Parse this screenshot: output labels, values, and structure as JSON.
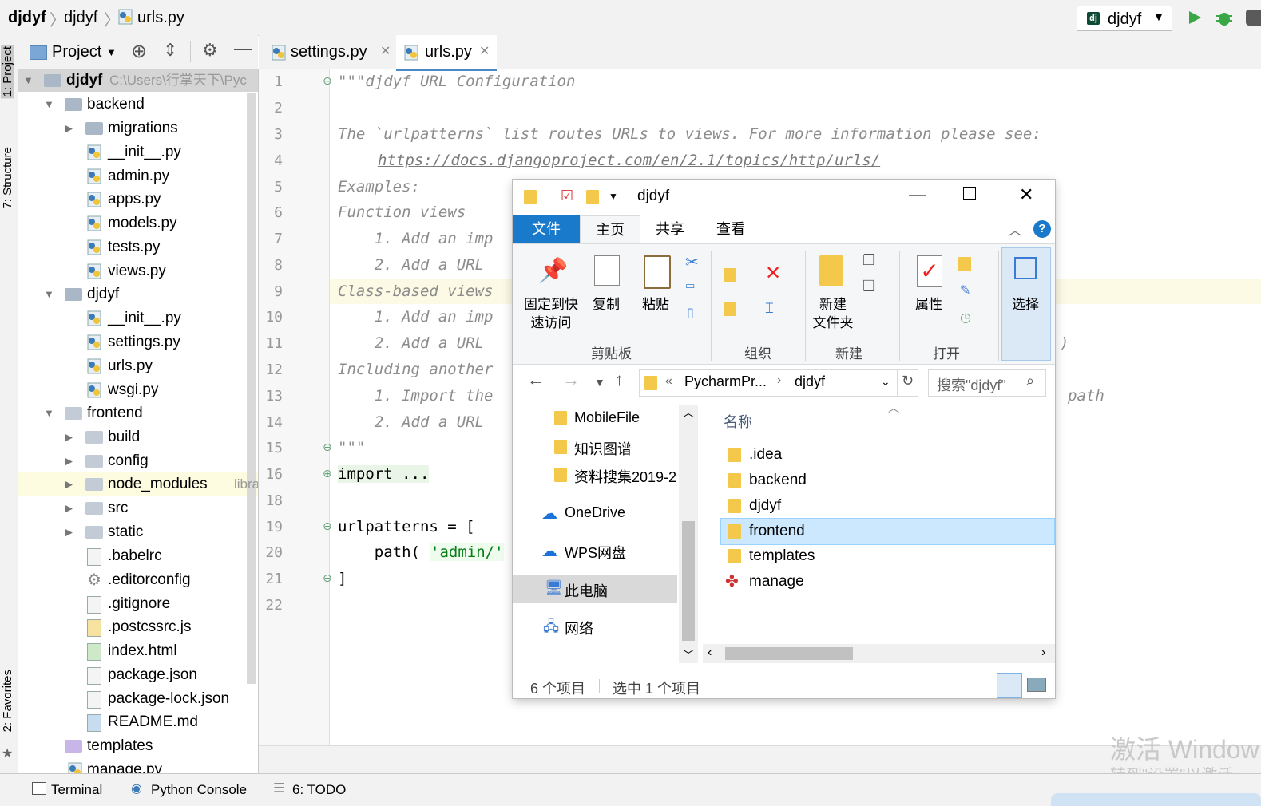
{
  "navbar": {
    "crumbs": [
      "djdyf",
      "djdyf",
      "urls.py"
    ],
    "run_config": "djdyf"
  },
  "left_strip": {
    "project": "1: Project",
    "structure": "7: Structure",
    "favorites": "2: Favorites"
  },
  "project_panel": {
    "title": "Project",
    "root": {
      "name": "djdyf",
      "path": "C:\\Users\\行掌天下\\Pyc"
    },
    "items": [
      {
        "label": "backend"
      },
      {
        "label": "migrations"
      },
      {
        "label": "__init__.py"
      },
      {
        "label": "admin.py"
      },
      {
        "label": "apps.py"
      },
      {
        "label": "models.py"
      },
      {
        "label": "tests.py"
      },
      {
        "label": "views.py"
      },
      {
        "label": "djdyf"
      },
      {
        "label": "__init__.py"
      },
      {
        "label": "settings.py"
      },
      {
        "label": "urls.py"
      },
      {
        "label": "wsgi.py"
      },
      {
        "label": "frontend"
      },
      {
        "label": "build"
      },
      {
        "label": "config"
      },
      {
        "label": "node_modules",
        "hint": "library"
      },
      {
        "label": "src"
      },
      {
        "label": "static"
      },
      {
        "label": ".babelrc"
      },
      {
        "label": ".editorconfig"
      },
      {
        "label": ".gitignore"
      },
      {
        "label": ".postcssrc.js"
      },
      {
        "label": "index.html"
      },
      {
        "label": "package.json"
      },
      {
        "label": "package-lock.json"
      },
      {
        "label": "README.md"
      },
      {
        "label": "templates"
      },
      {
        "label": "manage.py"
      }
    ]
  },
  "editor": {
    "tabs": [
      "settings.py",
      "urls.py"
    ],
    "line_numbers": [
      "1",
      "2",
      "3",
      "4",
      "5",
      "6",
      "7",
      "8",
      "9",
      "10",
      "11",
      "12",
      "13",
      "14",
      "15",
      "16",
      "18",
      "19",
      "20",
      "21",
      "22"
    ],
    "lines": {
      "l1": "\"\"\"djdyf URL Configuration",
      "l3": "The `urlpatterns` list routes URLs to views. For more information please see:",
      "l4": "https://docs.djangoproject.com/en/2.1/topics/http/urls/",
      "l5": "Examples:",
      "l6": "Function views",
      "l7": "    1. Add an imp",
      "l8": "    2. Add a URL",
      "l9": "Class-based views",
      "l10": "    1. Add an imp",
      "l11": "    2. Add a URL",
      "l12": "Including another",
      "l13": "    1. Import the",
      "l14": "    2. Add a URL",
      "l15": "\"\"\"",
      "l16": "import ...",
      "l19": "urlpatterns = [",
      "l20a": "    path(",
      "l20b": "'admin/'",
      "l21": "]",
      "l11_tail": ")",
      "l13_tail": "path"
    }
  },
  "explorer": {
    "title": "djdyf",
    "ribbon_tabs": [
      "文件",
      "主页",
      "共享",
      "查看"
    ],
    "buttons": {
      "pin": "固定到快\n速访问",
      "copy": "复制",
      "paste": "粘贴",
      "new_folder": "新建\n文件夹",
      "properties": "属性",
      "select": "选择"
    },
    "groups": [
      "剪贴板",
      "组织",
      "新建",
      "打开"
    ],
    "address": {
      "prefix": "«",
      "part1": "PycharmPr...",
      "part2": "djdyf"
    },
    "search_placeholder": "搜索\"djdyf\"",
    "nav_items": [
      "MobileFile",
      "知识图谱",
      "资料搜集2019-2",
      "OneDrive",
      "WPS网盘",
      "此电脑",
      "网络"
    ],
    "column_name": "名称",
    "files": [
      ".idea",
      "backend",
      "djdyf",
      "frontend",
      "templates",
      "manage"
    ],
    "selected_file": "frontend",
    "status_count": "6 个项目",
    "status_selected": "选中 1 个项目"
  },
  "statusbar": {
    "terminal": "Terminal",
    "python_console": "Python Console",
    "todo": "6: TODO"
  },
  "watermark": {
    "line1": "激活 Window",
    "line2": "转到\"设置\"以激活"
  },
  "colors": {
    "accent": "#4a88c7",
    "selection": "#cce8ff",
    "ribbon_file_tab": "#1979ca",
    "run_green": "#3aa745"
  }
}
